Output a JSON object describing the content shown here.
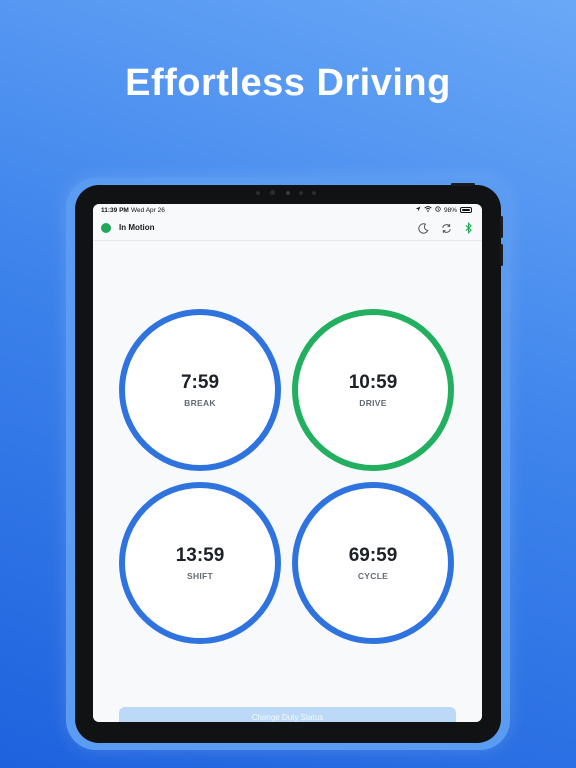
{
  "headline": "Effortless Driving",
  "status_bar": {
    "time": "11:39 PM",
    "date": "Wed Apr 26",
    "battery": "98%",
    "battery_level": 0.98
  },
  "nav": {
    "status_label": "In Motion",
    "status_color": "#22a85a",
    "accent_blue": "#2f74de",
    "accent_green": "#22b060",
    "icons": [
      "moon-icon",
      "sync-icon",
      "bluetooth-icon"
    ]
  },
  "timers": [
    {
      "value": "7:59",
      "label": "BREAK",
      "color": "#2f74de"
    },
    {
      "value": "10:59",
      "label": "DRIVE",
      "color": "#22b060"
    },
    {
      "value": "13:59",
      "label": "SHIFT",
      "color": "#2f74de"
    },
    {
      "value": "69:59",
      "label": "CYCLE",
      "color": "#2f74de"
    }
  ],
  "action_button": "Change Duty Status"
}
